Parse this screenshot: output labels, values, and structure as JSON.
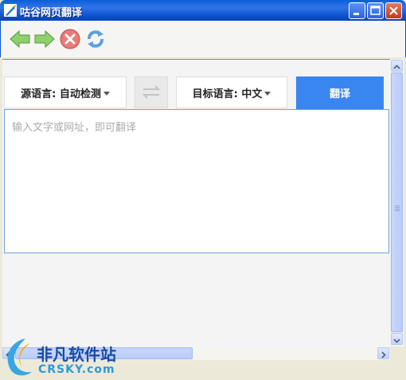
{
  "window": {
    "title": "咕谷网页翻译"
  },
  "toolbar": {
    "back_icon": "arrow-left-icon",
    "forward_icon": "arrow-right-icon",
    "stop_icon": "stop-icon",
    "refresh_icon": "refresh-icon"
  },
  "translator": {
    "source_lang_label": "源语言: 自动检测",
    "target_lang_label": "目标语言: 中文",
    "swap_icon": "swap-arrows-icon",
    "translate_label": "翻译",
    "input_placeholder": "输入文字或网址，即可翻译"
  },
  "watermark": {
    "name_cn": "非凡软件站",
    "name_en": "CRSKY.com"
  },
  "colors": {
    "accent": "#3a86f0",
    "titlebar": "#0b4fcf"
  }
}
